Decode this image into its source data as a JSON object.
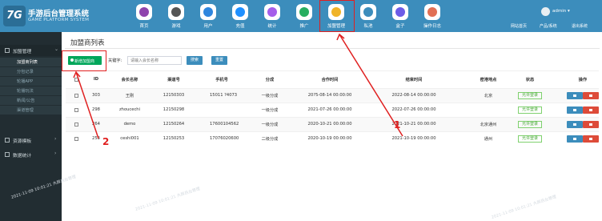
{
  "brand": {
    "logo_text": "7G",
    "title": "手游后台管理系统",
    "subtitle": "GAME PLATFORM SYSTEM"
  },
  "colors": {
    "topbar": "#3c8dbc",
    "sidebar": "#222d32",
    "success": "#00a65a",
    "danger": "#dd4b39",
    "annotation": "#e02020"
  },
  "nav": [
    {
      "label": "首页",
      "icon": "home-icon",
      "color": "#8e44ad"
    },
    {
      "label": "游戏",
      "icon": "gamepad-icon",
      "color": "#555555"
    },
    {
      "label": "用户",
      "icon": "user-icon",
      "color": "#2e86de"
    },
    {
      "label": "充值",
      "icon": "recharge-icon",
      "color": "#1e90ff"
    },
    {
      "label": "统计",
      "icon": "stats-icon",
      "color": "#a55eea"
    },
    {
      "label": "推广",
      "icon": "promo-icon",
      "color": "#27ae60"
    },
    {
      "label": "加盟管理",
      "icon": "franchise-icon",
      "color": "#f0b429"
    },
    {
      "label": "私池",
      "icon": "pool-icon",
      "color": "#3c8dbc"
    },
    {
      "label": "盒子",
      "icon": "box-icon",
      "color": "#6c5ce7"
    },
    {
      "label": "操作日志",
      "icon": "log-icon",
      "color": "#e17055"
    }
  ],
  "user": {
    "name": "admin ▾"
  },
  "top_links": [
    "网站首页",
    "产品/系统",
    "退出系统"
  ],
  "sidebar": {
    "groups": [
      {
        "label": "加盟管理",
        "icon": "menu-icon",
        "arrow": "⌄"
      },
      {
        "label": "资源模板",
        "icon": "folder-icon",
        "arrow": "›"
      },
      {
        "label": "数据统计",
        "icon": "chart-icon",
        "arrow": "›"
      }
    ],
    "items": [
      "加盟商列表",
      "分包记录",
      "轮播APP",
      "轮播玩法",
      "新闻/公告",
      "渠道管理"
    ]
  },
  "page": {
    "title": "加盟商列表"
  },
  "toolbar": {
    "add_label": "新增加盟商",
    "keyword_label": "关键字:",
    "keyword_placeholder": "请输入会长名称",
    "search_label": "搜索",
    "reset_label": "重置"
  },
  "table": {
    "headers": [
      "ID",
      "会长名称",
      "渠道号",
      "手机号",
      "分成",
      "合作时间",
      "结束时间",
      "密港地点",
      "状态",
      "操作"
    ],
    "rows": [
      {
        "id": "303",
        "name": "王刚",
        "channel": "12150303",
        "phone": "15011 ?4073",
        "share": "一级分成",
        "start": "20?5-08-14 00:00:00",
        "end": "2022-08-14 00:00:00",
        "place": "北京",
        "status": "允许登录"
      },
      {
        "id": "298",
        "name": "zhoucechi",
        "channel": "12150298",
        "phone": "",
        "share": "一级分成",
        "start": "2021-07-26 00:00:00",
        "end": "2022-07-26 00:00:00",
        "place": "",
        "status": "允许登录"
      },
      {
        "id": "264",
        "name": "demo",
        "channel": "12150264",
        "phone": "17600104562",
        "share": "一级分成",
        "start": "2020-10-21 00:00:00",
        "end": "2021-10-21 00:00:00",
        "place": "北京通州",
        "status": "允许登录"
      },
      {
        "id": "253",
        "name": "ceshi001",
        "channel": "12150253",
        "phone": "17076020600",
        "share": "二级分成",
        "start": "2020-10-19 00:00:00",
        "end": "2021-10-19 00:00:00",
        "place": "通州",
        "status": "允许登录"
      }
    ]
  },
  "annotations": [
    "1",
    "2"
  ],
  "watermarks": [
    "2021-11-09 10:01:21 大屏后台管理",
    "2021-11-09 10:01:21 大屏后台管理",
    "2021-11-09 10:01:21 大屏后台管理"
  ]
}
